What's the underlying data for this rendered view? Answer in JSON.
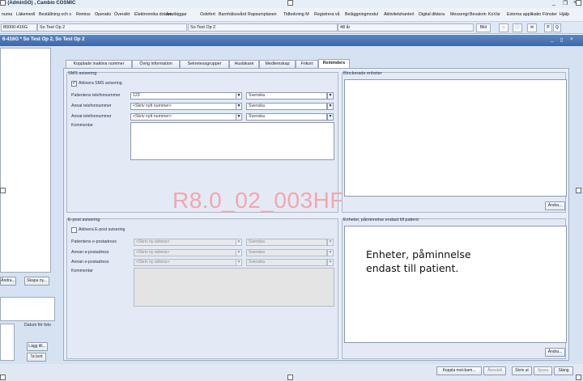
{
  "window": {
    "title": "re (AdminSO) , Cambio COSMIC",
    "controls": {
      "minimize": "_",
      "restore": "❐",
      "close": "×"
    }
  },
  "menu": {
    "items": [
      "numa",
      "Läkemedl",
      "Beställning och s",
      "Remiss",
      "Operatio",
      "Översikt",
      "Elektronnika dokum",
      "Anutläggar",
      "Ostefert",
      "Barnhälsovård",
      "Rapsumplanen",
      "Tidbokning M",
      "Registrera vå",
      "Beläggningmodul",
      "Aktivitetshanterl",
      "Digital diktera",
      "Messengr",
      "Bevakrin",
      "KoVär",
      "Externa applikatio",
      "Fönster",
      "Hjälp"
    ]
  },
  "infobar": {
    "personnummer": "80000-416G",
    "name": "So Test Op 2",
    "name2": "So Test Op 2",
    "age": "48 år",
    "btn_bild": "Bild",
    "btn_p": "P",
    "btn_q": "Q"
  },
  "inner_window": {
    "title": "6-416G * So Test Op 2, So Test Op 2",
    "controls": {
      "minimize": "_",
      "restore": "▯",
      "close": "×"
    }
  },
  "left": {
    "btn_andra": "Ändra...",
    "btn_skapa": "Skapa ny...",
    "datum_label": "Datum för foto",
    "btn_lagg_till": "Lägg till...",
    "btn_ta_bort": "Ta bort"
  },
  "tabs": [
    {
      "label": "Kopplade inaktiva nummer"
    },
    {
      "label": "Övrig information"
    },
    {
      "label": "Sekretessgrupper"
    },
    {
      "label": "Husläkare"
    },
    {
      "label": "Medlemskap"
    },
    {
      "label": "Frikort"
    },
    {
      "label": "Reminders"
    }
  ],
  "sms": {
    "title": "SMS avisering",
    "activate_label": "Aktivera SMS avisering",
    "activate_checked": "✓",
    "rows": [
      {
        "label": "Patientens telefonnummer",
        "value": "123",
        "lang": "Svenska"
      },
      {
        "label": "Annat telefonnummer",
        "value": "<Skriv nytt nummer>",
        "lang": "Svenska"
      },
      {
        "label": "Annat telefonnummer",
        "value": "<Skriv nytt nummer>",
        "lang": "Svenska"
      }
    ],
    "comment_label": "Kommentar"
  },
  "blocked": {
    "title": "Blockerade enheter",
    "btn_andra": "Ändra..."
  },
  "email": {
    "title": "E-post avisering",
    "activate_label": "Aktivera E-post avisering",
    "rows": [
      {
        "label": "Patientens e-postadress",
        "value": "<Skriv ny adress>",
        "lang": "Svenska"
      },
      {
        "label": "Annan e-postadress",
        "value": "<Skriv ny adress>",
        "lang": "Svenska"
      },
      {
        "label": "Annan e-postadress",
        "value": "<Skriv ny adress>",
        "lang": "Svenska"
      }
    ],
    "comment_label": "Kommentar"
  },
  "patient_only": {
    "title": "Enheter, påminnelse endast till patient",
    "btn_andra": "Ändra..."
  },
  "watermark": "R8.0_02_003HF",
  "note": "Enheter, påminnelse endast till patient.",
  "bottom": {
    "btn_koppla": "Koppla mot-bam...",
    "btn_aterstall": "Återställ",
    "btn_skriv_ut": "Skriv ut",
    "btn_spara": "Spara",
    "btn_stang": "Stäng"
  },
  "colors": {
    "accent": "#3e67a8",
    "panel": "#e3eaf5",
    "watermark": "#f2a7ac"
  }
}
